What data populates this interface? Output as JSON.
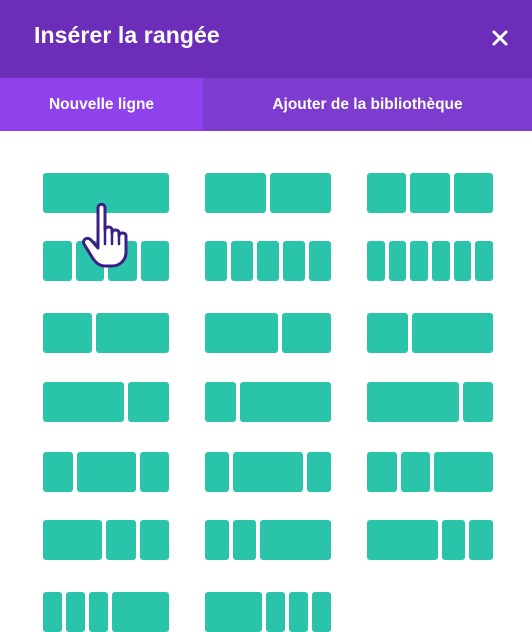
{
  "header": {
    "title": "Insérer la rangée",
    "close_icon": "close-icon"
  },
  "tabs": [
    {
      "label": "Nouvelle ligne",
      "active": true
    },
    {
      "label": "Ajouter de la bibliothèque",
      "active": false
    }
  ],
  "colors": {
    "header_bg": "#6c2eb9",
    "tabs_bg": "#7d3bcf",
    "active_tab_bg": "#8f42ec",
    "column_fill": "#29c4a9"
  },
  "row_layouts": [
    {
      "id": "1",
      "columns": [
        "1"
      ]
    },
    {
      "id": "1_2,1_2",
      "columns": [
        "1/2",
        "1/2"
      ]
    },
    {
      "id": "1_3,1_3,1_3",
      "columns": [
        "1/3",
        "1/3",
        "1/3"
      ]
    },
    {
      "id": "1_4x4",
      "columns": [
        "1/4",
        "1/4",
        "1/4",
        "1/4"
      ]
    },
    {
      "id": "1_5x5",
      "columns": [
        "1/5",
        "1/5",
        "1/5",
        "1/5",
        "1/5"
      ]
    },
    {
      "id": "1_6x6",
      "columns": [
        "1/6",
        "1/6",
        "1/6",
        "1/6",
        "1/6",
        "1/6"
      ]
    },
    {
      "id": "2_5,3_5",
      "columns": [
        "2/5",
        "3/5"
      ]
    },
    {
      "id": "3_5,2_5",
      "columns": [
        "3/5",
        "2/5"
      ]
    },
    {
      "id": "1_3,2_3",
      "columns": [
        "1/3",
        "2/3"
      ]
    },
    {
      "id": "2_3,1_3",
      "columns": [
        "2/3",
        "1/3"
      ]
    },
    {
      "id": "1_4,3_4",
      "columns": [
        "1/4",
        "3/4"
      ]
    },
    {
      "id": "3_4,1_4",
      "columns": [
        "3/4",
        "1/4"
      ]
    },
    {
      "id": "1_4,1_2,1_4",
      "columns": [
        "1/4",
        "1/2",
        "1/4"
      ]
    },
    {
      "id": "1_5,3_5,1_5",
      "columns": [
        "1/5",
        "3/5",
        "1/5"
      ]
    },
    {
      "id": "1_4,1_4,1_2",
      "columns": [
        "1/4",
        "1/4",
        "1/2"
      ]
    },
    {
      "id": "1_2,1_4,1_4",
      "columns": [
        "1/2",
        "1/4",
        "1/4"
      ]
    },
    {
      "id": "1_5,1_5,3_5",
      "columns": [
        "1/5",
        "1/5",
        "3/5"
      ]
    },
    {
      "id": "3_5,1_5,1_5",
      "columns": [
        "3/5",
        "1/5",
        "1/5"
      ]
    },
    {
      "id": "1_6,1_6,1_6,1_2",
      "columns": [
        "1/6",
        "1/6",
        "1/6",
        "1/2"
      ]
    },
    {
      "id": "1_2,1_6,1_6,1_6",
      "columns": [
        "1/2",
        "1/6",
        "1/6",
        "1/6"
      ]
    }
  ],
  "pointer": {
    "icon": "hand-pointer-icon"
  }
}
